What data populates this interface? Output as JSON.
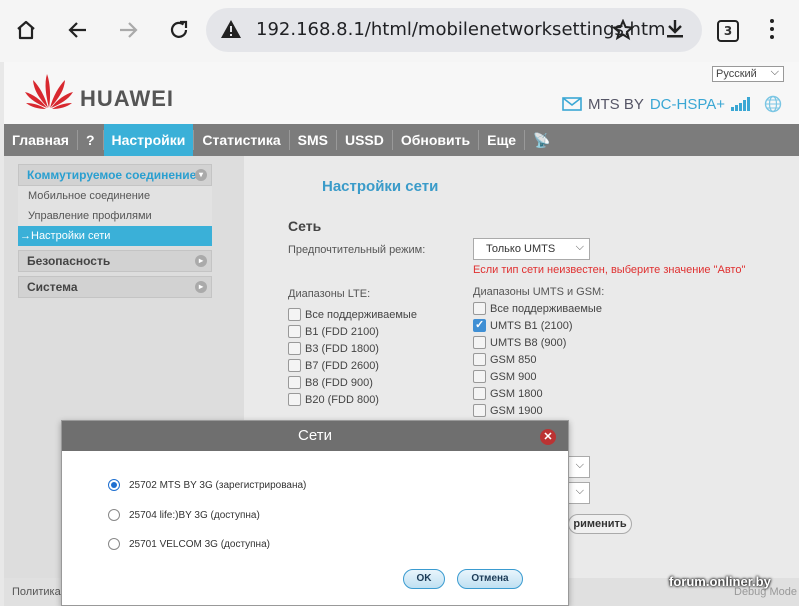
{
  "browser": {
    "url": "192.168.8.1/html/mobilenetworksettings.htm",
    "tab_count": "3"
  },
  "header": {
    "brand": "HUAWEI",
    "language": "Русский",
    "operator": "MTS BY",
    "network_type": "DC-HSPA+"
  },
  "nav": {
    "items": [
      "Главная",
      "?",
      "Настройки",
      "Статистика",
      "SMS",
      "USSD",
      "Обновить",
      "Еще"
    ],
    "active": "Настройки"
  },
  "sidebar": {
    "group_dialup": "Коммутируемое соединение",
    "sub_mobile": "Мобильное соединение",
    "sub_profiles": "Управление профилями",
    "sub_network": "→Настройки сети",
    "group_security": "Безопасность",
    "group_system": "Система"
  },
  "main": {
    "title": "Настройки сети",
    "section": "Сеть",
    "preferred_mode_label": "Предпочтительный режим:",
    "preferred_mode_value": "Только UMTS",
    "hint": "Если тип сети неизвестен, выберите значение \"Авто\"",
    "lte_label": "Диапазоны LTE:",
    "lte_bands": [
      {
        "label": "Все поддерживаемые",
        "checked": false
      },
      {
        "label": "B1 (FDD 2100)",
        "checked": false
      },
      {
        "label": "B3 (FDD 1800)",
        "checked": false
      },
      {
        "label": "B7 (FDD 2600)",
        "checked": false
      },
      {
        "label": "B8 (FDD 900)",
        "checked": false
      },
      {
        "label": "B20 (FDD 800)",
        "checked": false
      }
    ],
    "umts_label": "Диапазоны UMTS и GSM:",
    "umts_bands": [
      {
        "label": "Все поддерживаемые",
        "checked": false
      },
      {
        "label": "UMTS B1 (2100)",
        "checked": true
      },
      {
        "label": "UMTS B8 (900)",
        "checked": false
      },
      {
        "label": "GSM 850",
        "checked": false
      },
      {
        "label": "GSM 900",
        "checked": false
      },
      {
        "label": "GSM 1800",
        "checked": false
      },
      {
        "label": "GSM 1900",
        "checked": false
      }
    ],
    "apply_partial": "рименить"
  },
  "footer": {
    "policy_partial": "Политика",
    "debug_partial": "Debug Mode"
  },
  "watermark": "forum.onliner.by",
  "dialog": {
    "title": "Сети",
    "networks": [
      {
        "label": "25702 MTS BY 3G  (зарегистрирована)",
        "selected": true
      },
      {
        "label": "25704 life:)BY 3G  (доступна)",
        "selected": false
      },
      {
        "label": "25701 VELCOM 3G  (доступна)",
        "selected": false
      }
    ],
    "ok": "OK",
    "cancel": "Отмена"
  },
  "colors": {
    "accent": "#3ab0d8",
    "nav_bg": "#7c7c7c",
    "hint_red": "#e03030"
  }
}
